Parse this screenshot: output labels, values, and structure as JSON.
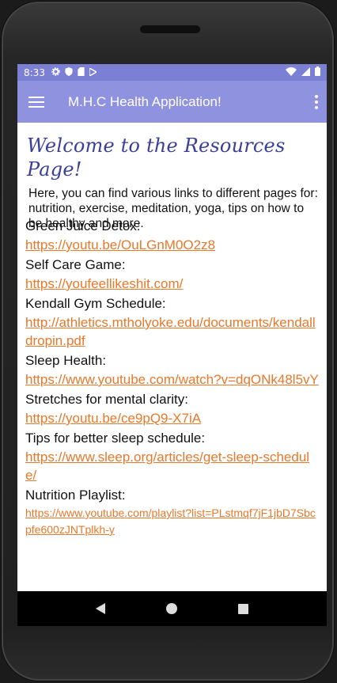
{
  "status_bar": {
    "time": "8:33",
    "icons": [
      "settings-icon",
      "shield-icon",
      "sd-card-icon",
      "play-store-icon",
      "wifi-icon",
      "signal-icon",
      "battery-icon"
    ]
  },
  "app_bar": {
    "title": "M.H.C Health Application!",
    "menu_icon": "hamburger-menu-icon",
    "overflow_icon": "more-vert-icon"
  },
  "page": {
    "title": "Welcome to the Resources Page!",
    "intro": "Here, you can find various links to different pages for: nutrition, exercise, meditation, yoga, tips on how to be healthy and more."
  },
  "resources": [
    {
      "label": "Green Juice Detox:",
      "link": "https://youtu.be/OuLGnM0O2z8"
    },
    {
      "label": "Self Care Game:",
      "link": "https://youfeellikeshit.com/"
    },
    {
      "label": "Kendall Gym Schedule:",
      "link": "http://athletics.mtholyoke.edu/documents/kendalldropin.pdf"
    },
    {
      "label": "Sleep Health:",
      "link": "https://www.youtube.com/watch?v=dqONk48l5vY"
    },
    {
      "label": "Stretches for mental clarity:",
      "link": "https://youtu.be/ce9pQ9-X7iA"
    },
    {
      "label": "Tips for better sleep schedule:",
      "link": "https://www.sleep.org/articles/get-sleep-schedule/"
    },
    {
      "label": "Nutrition Playlist:",
      "link": "https://www.youtube.com/playlist?list=PLstmqf7jF1jbD7Sbcpfe600zJNTplkh-y"
    }
  ],
  "nav_bar": {
    "back_icon": "back-triangle-icon",
    "home_icon": "home-circle-icon",
    "recents_icon": "recents-square-icon"
  },
  "colors": {
    "status_bar": "#7c80d4",
    "app_bar": "#8f93df",
    "title": "#3b3f9a",
    "link": "#e8782a"
  }
}
